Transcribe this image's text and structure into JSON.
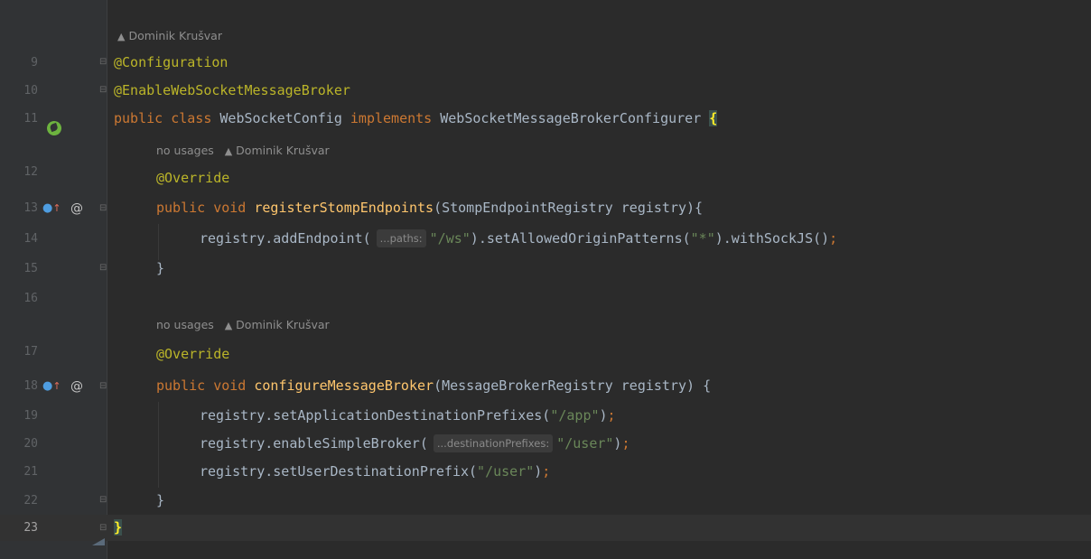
{
  "editor": {
    "top_line_number": "",
    "hints": {
      "class_author": "Dominik Krušvar",
      "method1_usages": "no usages",
      "method1_author": "Dominik Krušvar",
      "method2_usages": "no usages",
      "method2_author": "Dominik Krušvar"
    },
    "line_numbers": [
      "9",
      "10",
      "11",
      "12",
      "13",
      "14",
      "15",
      "16",
      "17",
      "18",
      "19",
      "20",
      "21",
      "22",
      "23"
    ],
    "code": {
      "l9": "@Configuration",
      "l10": "@EnableWebSocketMessageBroker",
      "l11_kw1": "public class ",
      "l11_name": "WebSocketConfig ",
      "l11_kw2": "implements ",
      "l11_iface": "WebSocketMessageBrokerConfigurer ",
      "l11_brace": "{",
      "l12": "@Override",
      "l13_kw": "public void ",
      "l13_fn": "registerStompEndpoints",
      "l13_rest": "(StompEndpointRegistry registry){",
      "l14_a": "registry.addEndpoint(",
      "l14_hint": "...paths:",
      "l14_str1": "\"/ws\"",
      "l14_b": ").setAllowedOriginPatterns(",
      "l14_str2": "\"*\"",
      "l14_c": ").withSockJS()",
      "l14_semi": ";",
      "l15": "}",
      "l17": "@Override",
      "l18_kw": "public void ",
      "l18_fn": "configureMessageBroker",
      "l18_rest": "(MessageBrokerRegistry registry) {",
      "l19_a": "registry.setApplicationDestinationPrefixes(",
      "l19_str": "\"/app\"",
      "l19_b": ")",
      "l19_semi": ";",
      "l20_a": "registry.enableSimpleBroker(",
      "l20_hint": "...destinationPrefixes:",
      "l20_str": "\"/user\"",
      "l20_b": ")",
      "l20_semi": ";",
      "l21_a": "registry.setUserDestinationPrefix(",
      "l21_str": "\"/user\"",
      "l21_b": ")",
      "l21_semi": ";",
      "l22": "}",
      "l23": "}"
    }
  },
  "colors": {
    "background": "#2b2b2b",
    "gutter": "#313335",
    "keyword": "#cc7832",
    "annotation": "#bbb529",
    "string": "#6a8759",
    "method": "#ffc66d",
    "text": "#a9b7c6",
    "brace_match": "#3b514d"
  },
  "icons": {
    "spring_bean": "spring-bean-icon",
    "override": "override-up-arrow-icon",
    "annotation": "at-sign-icon",
    "author": "person-icon",
    "fold": "fold-marker-icon"
  }
}
